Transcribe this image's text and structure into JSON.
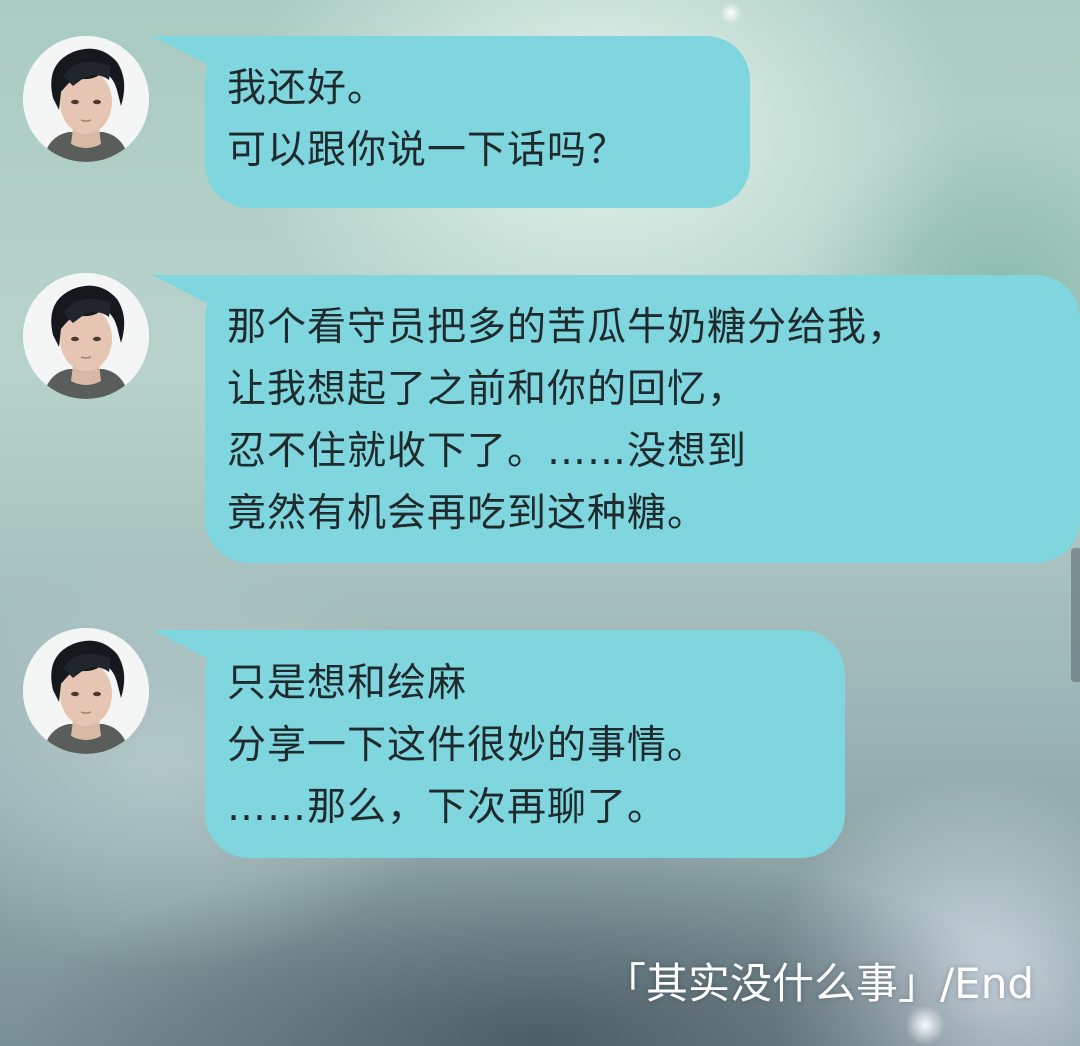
{
  "messages": [
    {
      "sender": "avatar",
      "lines": [
        "我还好。",
        "可以跟你说一下话吗？"
      ]
    },
    {
      "sender": "avatar",
      "lines": [
        "那个看守员把多的苦瓜牛奶糖分给我，",
        "让我想起了之前和你的回忆，",
        "忍不住就收下了。……没想到",
        "竟然有机会再吃到这种糖。"
      ]
    },
    {
      "sender": "avatar",
      "lines": [
        "只是想和绘麻",
        "分享一下这件很妙的事情。",
        "……那么，下次再聊了。"
      ]
    }
  ],
  "footer": {
    "text": "「其实没什么事」/End"
  },
  "colors": {
    "bubble": "#7fd6de",
    "text": "#1f2a2c",
    "footer_text": "#ffffff"
  },
  "icons": {
    "avatar": "male-avatar-portrait"
  }
}
